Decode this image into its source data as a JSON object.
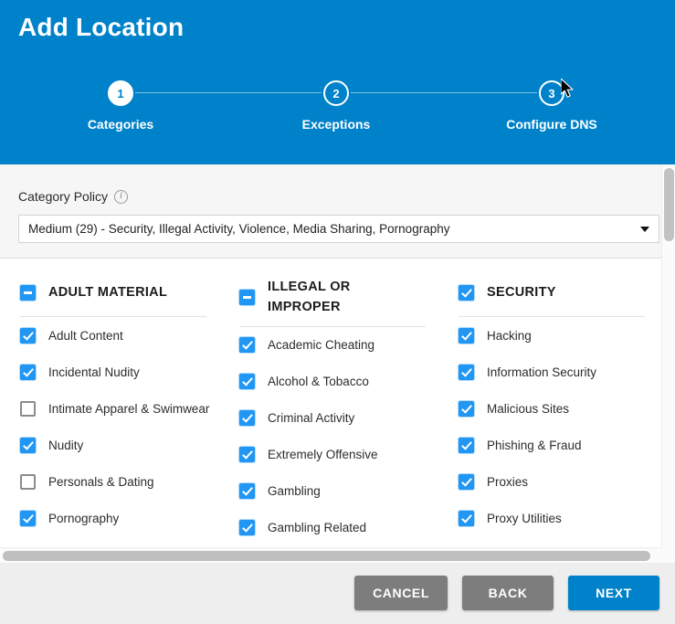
{
  "header": {
    "title": "Add Location",
    "steps": [
      {
        "number": "1",
        "label": "Categories",
        "state": "active"
      },
      {
        "number": "2",
        "label": "Exceptions",
        "state": "inactive"
      },
      {
        "number": "3",
        "label": "Configure DNS",
        "state": "inactive"
      }
    ]
  },
  "policy": {
    "label": "Category Policy",
    "info_icon": "info-icon",
    "selected": "Medium (29) - Security, Illegal Activity, Violence, Media Sharing, Pornography",
    "caret_icon": "chevron-down-icon"
  },
  "columns": [
    {
      "title": "ADULT MATERIAL",
      "group_state": "indeterminate",
      "items": [
        {
          "label": "Adult Content",
          "checked": true
        },
        {
          "label": "Incidental Nudity",
          "checked": true
        },
        {
          "label": "Intimate Apparel & Swimwear",
          "checked": false
        },
        {
          "label": "Nudity",
          "checked": true
        },
        {
          "label": "Personals & Dating",
          "checked": false
        },
        {
          "label": "Pornography",
          "checked": true
        }
      ]
    },
    {
      "title": "ILLEGAL OR IMPROPER",
      "group_state": "indeterminate",
      "items": [
        {
          "label": "Academic Cheating",
          "checked": true
        },
        {
          "label": "Alcohol & Tobacco",
          "checked": true
        },
        {
          "label": "Criminal Activity",
          "checked": true
        },
        {
          "label": "Extremely Offensive",
          "checked": true
        },
        {
          "label": "Gambling",
          "checked": true
        },
        {
          "label": "Gambling Related",
          "checked": true
        }
      ]
    },
    {
      "title": "SECURITY",
      "group_state": "checked",
      "items": [
        {
          "label": "Hacking",
          "checked": true
        },
        {
          "label": "Information Security",
          "checked": true
        },
        {
          "label": "Malicious Sites",
          "checked": true
        },
        {
          "label": "Phishing & Fraud",
          "checked": true
        },
        {
          "label": "Proxies",
          "checked": true
        },
        {
          "label": "Proxy Utilities",
          "checked": true
        }
      ]
    }
  ],
  "footer": {
    "cancel_label": "CANCEL",
    "back_label": "BACK",
    "next_label": "NEXT"
  },
  "colors": {
    "brand_blue": "#0082ca",
    "checkbox_blue": "#2196f3",
    "button_grey": "#7d7d7d",
    "panel_grey": "#f6f6f6",
    "footer_grey": "#eeeeee"
  }
}
